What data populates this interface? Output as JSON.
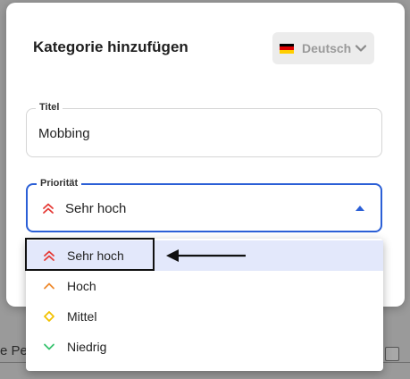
{
  "dialog": {
    "title": "Kategorie hinzufügen",
    "language": {
      "label": "Deutsch",
      "flag": "german-flag-icon"
    }
  },
  "fields": {
    "title": {
      "legend": "Titel",
      "value": "Mobbing"
    },
    "priority": {
      "legend": "Priorität",
      "value": "Sehr hoch"
    }
  },
  "priority_options": [
    {
      "label": "Sehr hoch",
      "icon": "double-chevron-up-icon",
      "color": "#e53935",
      "selected": true
    },
    {
      "label": "Hoch",
      "icon": "chevron-up-icon",
      "color": "#ef8a2e",
      "selected": false
    },
    {
      "label": "Mittel",
      "icon": "diamond-icon",
      "color": "#f2c200",
      "selected": false
    },
    {
      "label": "Niedrig",
      "icon": "chevron-down-icon",
      "color": "#37c26e",
      "selected": false
    }
  ],
  "background_fragments": {
    "frag_a": "e Pe"
  },
  "colors": {
    "accent": "#2b5fd6",
    "selected_bg": "#e3e8fb"
  }
}
